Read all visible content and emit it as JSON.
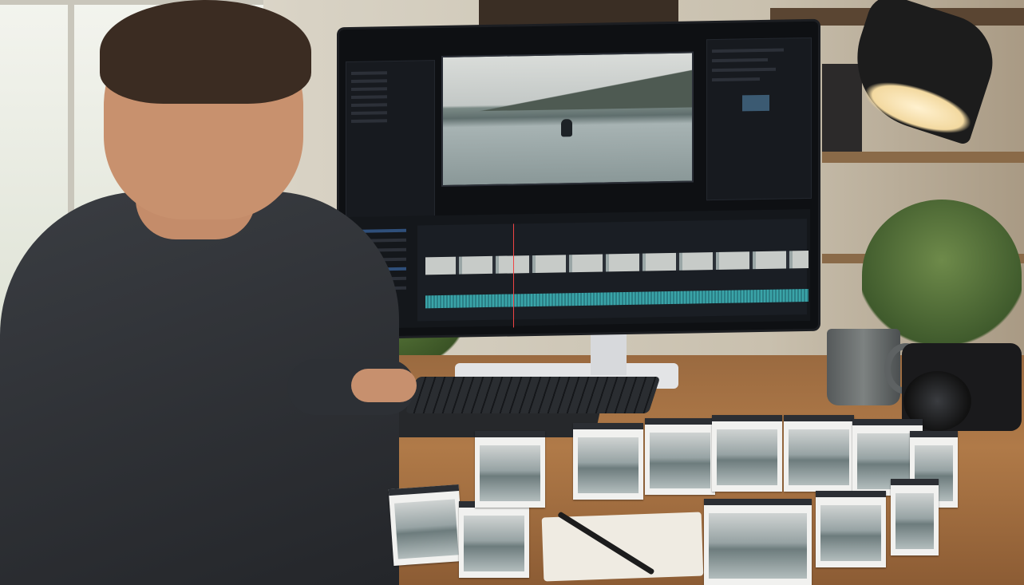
{
  "scene": {
    "description_tags": [
      "person",
      "monitor",
      "video-editor",
      "desk",
      "film-strip",
      "lamp",
      "mug",
      "camera",
      "plants"
    ]
  },
  "editor": {
    "preview_subject": "kayaker-on-lake"
  },
  "colors": {
    "desk_wood": "#a87245",
    "sweater": "#2e3136",
    "ui_background": "#14171b",
    "audio_waveform": "#3aa4a8",
    "playhead": "#ee4444"
  }
}
